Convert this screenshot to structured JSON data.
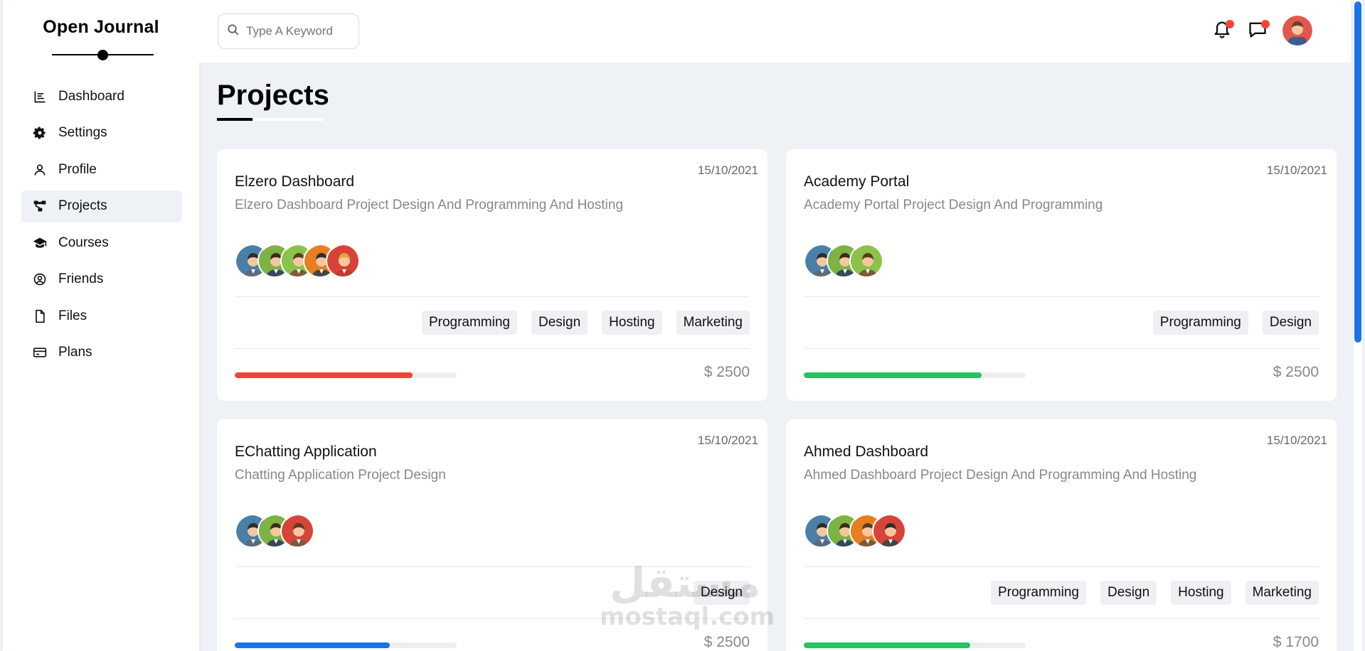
{
  "brand": {
    "name": "Open Journal"
  },
  "sidebar": {
    "items": [
      {
        "label": "Dashboard",
        "icon": "chart-bar-icon",
        "active": false
      },
      {
        "label": "Settings",
        "icon": "gear-icon",
        "active": false
      },
      {
        "label": "Profile",
        "icon": "user-icon",
        "active": false
      },
      {
        "label": "Projects",
        "icon": "diagram-icon",
        "active": true
      },
      {
        "label": "Courses",
        "icon": "graduation-cap-icon",
        "active": false
      },
      {
        "label": "Friends",
        "icon": "user-circle-icon",
        "active": false
      },
      {
        "label": "Files",
        "icon": "file-icon",
        "active": false
      },
      {
        "label": "Plans",
        "icon": "credit-card-icon",
        "active": false
      }
    ]
  },
  "header": {
    "search_placeholder": "Type A Keyword",
    "icons": [
      "bell-icon",
      "chat-icon",
      "avatar"
    ]
  },
  "main": {
    "title": "Projects",
    "projects": [
      {
        "date": "15/10/2021",
        "title": "Elzero Dashboard",
        "description": "Elzero Dashboard Project Design And Programming And Hosting",
        "avatars": [
          "#4a7fa8",
          "#7cb342",
          "#8bc34a",
          "#e67e22",
          "#d84339"
        ],
        "tags": [
          "Programming",
          "Design",
          "Hosting",
          "Marketing"
        ],
        "progress": 0.8,
        "progress_color": "#f44336",
        "price": "2500"
      },
      {
        "date": "15/10/2021",
        "title": "Academy Portal",
        "description": "Academy Portal Project Design And Programming",
        "avatars": [
          "#4a7fa8",
          "#7cb342",
          "#8bc34a"
        ],
        "tags": [
          "Programming",
          "Design"
        ],
        "progress": 0.8,
        "progress_color": "#22c55e",
        "price": "2500"
      },
      {
        "date": "15/10/2021",
        "title": "EChatting Application",
        "description": "Chatting Application Project Design",
        "avatars": [
          "#4a7fa8",
          "#7cb342",
          "#d84339"
        ],
        "tags": [
          "Design"
        ],
        "progress": 0.7,
        "progress_color": "#1a73e8",
        "price": "2500"
      },
      {
        "date": "15/10/2021",
        "title": "Ahmed Dashboard",
        "description": "Ahmed Dashboard Project Design And Programming And Hosting",
        "avatars": [
          "#4a7fa8",
          "#7cb342",
          "#e67e22",
          "#d84339"
        ],
        "tags": [
          "Programming",
          "Design",
          "Hosting",
          "Marketing"
        ],
        "progress": 0.75,
        "progress_color": "#22c55e",
        "price": "1700"
      }
    ]
  },
  "watermark": {
    "arabic": "مستقل",
    "latin": "mostaql.com"
  }
}
